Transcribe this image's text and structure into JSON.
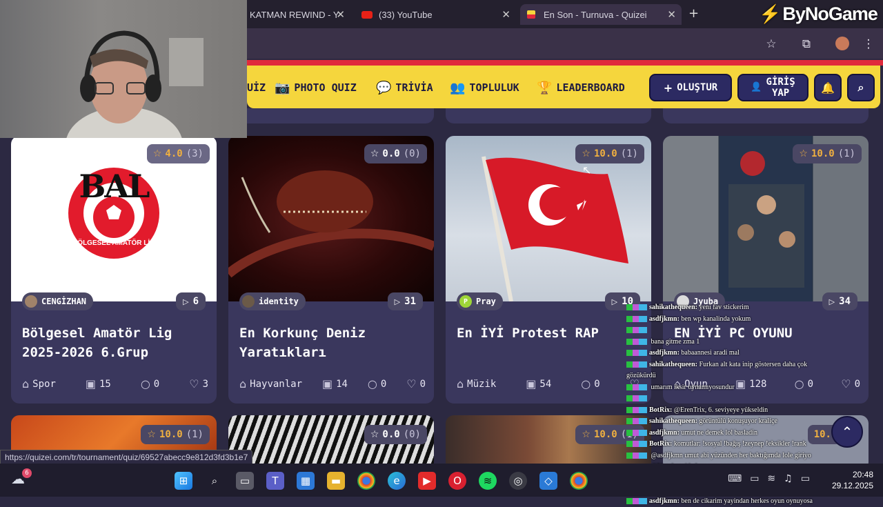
{
  "browser": {
    "tabs": [
      {
        "label": "KATMAN REWIND - Y",
        "icon": "generic-tab-icon"
      },
      {
        "label": "(33) YouTube",
        "icon": "youtube-icon"
      },
      {
        "label": "En Son - Turnuva - Quizei",
        "icon": "quizei-icon",
        "active": true
      }
    ],
    "overlay_logo": "ByNoGame",
    "status_url": "https://quizei.com/tr/tournament/quiz/69527abecc9e812d3fd3b1e7"
  },
  "nav": {
    "partial_item": "UİZ",
    "items": [
      {
        "label": "PHOTO QUIZ",
        "icon": "camera-icon"
      },
      {
        "label": "TRİVİA",
        "icon": "chat-question-icon"
      },
      {
        "label": "TOPLULUK",
        "icon": "users-icon"
      },
      {
        "label": "LEADERBOARD",
        "icon": "trophy-icon"
      }
    ],
    "create_label": "OLUŞTUR",
    "login_label_1": "GİRİŞ",
    "login_label_2": "YAP"
  },
  "cards": [
    {
      "rating": "4.0",
      "rating_count": "(3)",
      "author": "CENGİZHAN",
      "plays": "6",
      "title": "Bölgesel Amatör Lig 2025-2026 6.Grup",
      "category": "Spor",
      "questions": "15",
      "comments": "0",
      "likes": "3",
      "logo_text": "BAL",
      "logo_ring": "BÖLGESEL AMATÖR LİG"
    },
    {
      "rating": "0.0",
      "rating_count": "(0)",
      "author": "identity",
      "plays": "31",
      "title": "En Korkunç Deniz Yaratıkları",
      "category": "Hayvanlar",
      "questions": "14",
      "comments": "0",
      "likes": "0"
    },
    {
      "rating": "10.0",
      "rating_count": "(1)",
      "author": "Pray",
      "author_initial": "P",
      "plays": "10",
      "title": "En İYİ Protest RAP",
      "category": "Müzik",
      "questions": "54",
      "comments": "0",
      "likes": ""
    },
    {
      "rating": "10.0",
      "rating_count": "(1)",
      "author": "Jyuba",
      "plays": "34",
      "title": "EN İYİ PC OYUNU",
      "category": "Oyun",
      "questions": "128",
      "comments": "0",
      "likes": "0"
    }
  ],
  "row2_ratings": [
    {
      "rating": "10.0",
      "rating_count": "(1)"
    },
    {
      "rating": "0.0",
      "rating_count": "(0)"
    },
    {
      "rating": "10.0",
      "rating_count": "(1)"
    },
    {
      "rating": "10.",
      "rating_count": ""
    }
  ],
  "chat": [
    {
      "user": "sahikathequeen:",
      "msg": "yeni fav stickerim"
    },
    {
      "user": "asdfjkmn:",
      "msg": "ben wp kanalinda yokum"
    },
    {
      "user": "",
      "msg": ""
    },
    {
      "user": "",
      "msg": "bana gitme zma 1"
    },
    {
      "user": "asdfjkmn:",
      "msg": "babaannesi aradi mal"
    },
    {
      "user": "sahikathequeen:",
      "msg": "Furkan alt kata inip göstersen daha çok gözükürdü"
    },
    {
      "user": "",
      "msg": "umarım iksir oynamıyosundur"
    },
    {
      "user": "",
      "msg": ""
    },
    {
      "user": "BotRix:",
      "msg": "@ErenTrix, 6. seviyeye yükseldin"
    },
    {
      "user": "sahikathequeen:",
      "msg": "görüntülü konuşuyor kraliçe"
    },
    {
      "user": "asdfjkmn:",
      "msg": "umut ne demek lol basladin"
    },
    {
      "user": "BotRix:",
      "msg": "komutlar: !sosyal !bağış !zeynep !eksikler !rank"
    },
    {
      "user": "",
      "msg": "@asdfjkmn umut abi yüzünden her baktığımda lole giriyo"
    },
    {
      "user": "",
      "msg": "@Nanchangi bakma sen ona"
    },
    {
      "user": "",
      "msg": ""
    },
    {
      "user": "",
      "msg": "naber"
    },
    {
      "user": "asdfjkmn:",
      "msg": "ben de cikarim yayindan herkes oyun oynuyosa"
    }
  ],
  "taskbar": {
    "weather_badge": "6",
    "time": "20:48",
    "date": "29.12.2025"
  }
}
